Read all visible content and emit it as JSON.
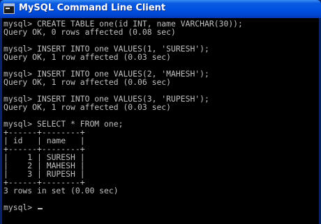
{
  "window": {
    "title": "MySQL Command Line Client",
    "icon": "console-icon"
  },
  "console": {
    "lines": [
      "mysql> CREATE TABLE one(id INT, name VARCHAR(30));",
      "Query OK, 0 rows affected (0.08 sec)",
      "mysql> INSERT INTO one VALUES(1, 'SURESH');",
      "Query OK, 1 row affected (0.03 sec)",
      "mysql> INSERT INTO one VALUES(2, 'MAHESH');",
      "Query OK, 1 row affected (0.06 sec)",
      "mysql> INSERT INTO one VALUES(3, 'RUPESH');",
      "Query OK, 1 row affected (0.03 sec)",
      "mysql> SELECT * FROM one;",
      "+------+--------+",
      "| id   | name   |",
      "+------+--------+",
      "|    1 | SURESH |",
      "|    2 | MAHESH |",
      "|    3 | RUPESH |",
      "+------+--------+",
      "3 rows in set (0.00 sec)",
      "mysql> "
    ]
  }
}
